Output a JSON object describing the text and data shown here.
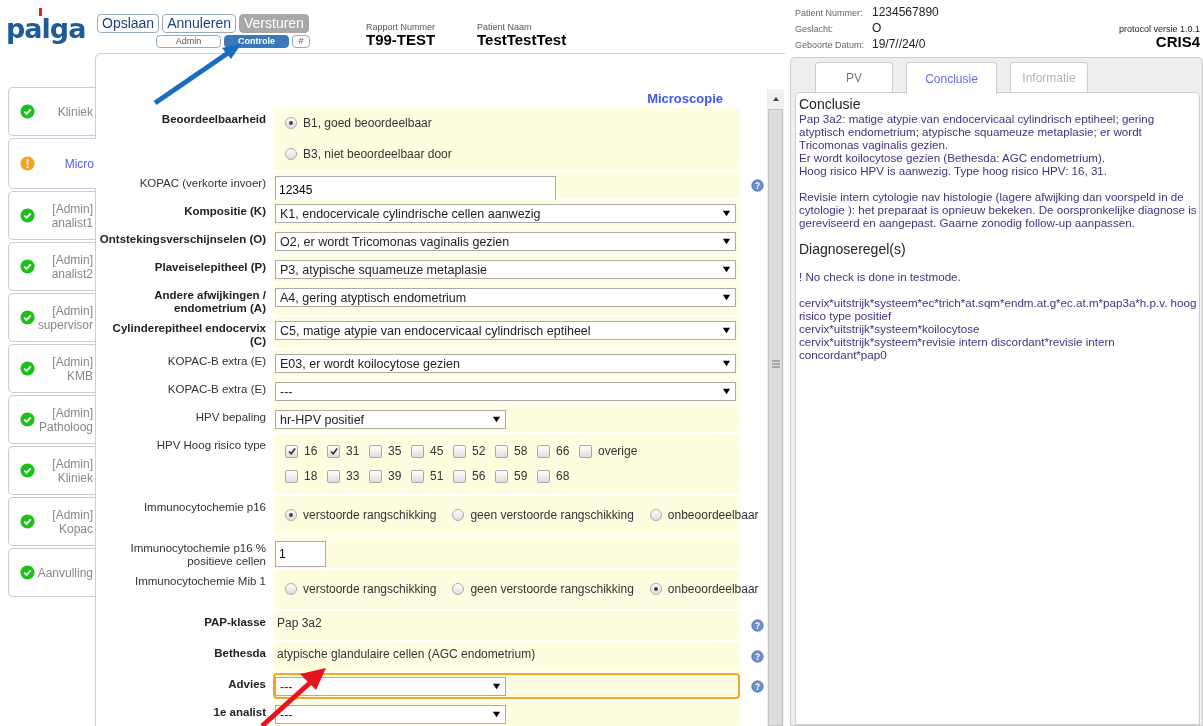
{
  "header": {
    "logo": "palga",
    "buttons": [
      {
        "label": "Opslaan",
        "disabled": false
      },
      {
        "label": "Annuleren",
        "disabled": false
      },
      {
        "label": "Versturen",
        "disabled": true
      }
    ],
    "mode_tabs": [
      {
        "label": "Admin",
        "selected": false
      },
      {
        "label": "Controle",
        "selected": true
      },
      {
        "label": "#",
        "selected": false
      }
    ],
    "report": [
      {
        "caption": "Rapport Nummer",
        "value": "T99-TEST"
      },
      {
        "caption": "Patient Naam",
        "value": "TestTestTest"
      }
    ]
  },
  "sidebar": {
    "items": [
      {
        "label": "Kliniek",
        "complete": true,
        "selected": false
      },
      {
        "label": "Micro",
        "complete": false,
        "selected": true
      },
      {
        "label": "[Admin] analist1",
        "complete": true,
        "selected": false
      },
      {
        "label": "[Admin] analist2",
        "complete": true,
        "selected": false
      },
      {
        "label": "[Admin] supervisor",
        "complete": true,
        "selected": false
      },
      {
        "label": "[Admin] KMB",
        "complete": true,
        "selected": false
      },
      {
        "label": "[Admin] Patholoog",
        "complete": true,
        "selected": false
      },
      {
        "label": "[Admin] Kliniek",
        "complete": true,
        "selected": false
      },
      {
        "label": "[Admin] Kopac",
        "complete": true,
        "selected": false
      },
      {
        "label": "Aanvulling",
        "complete": true,
        "selected": false
      }
    ]
  },
  "form": {
    "title": "Microscopie",
    "rows": [
      {
        "kind": "radio_list",
        "label": "Beoordeelbaarheid",
        "bold": true,
        "help": false,
        "options": [
          {
            "label": "B1, goed beoordeelbaar",
            "selected": true
          },
          {
            "label": "B3, niet beoordeelbaar door",
            "selected": false
          }
        ]
      },
      {
        "kind": "text_input",
        "label": "KOPAC (verkorte invoer)",
        "bold": false,
        "help": true,
        "value": "12345"
      },
      {
        "kind": "select",
        "label": "Kompositie (K)",
        "bold": true,
        "help": false,
        "focused": false,
        "value": "K1, endocervicale cylindrische cellen aanwezig"
      },
      {
        "kind": "select",
        "label": "Ontstekingsverschijnselen (O)",
        "bold": true,
        "help": false,
        "focused": false,
        "value": "O2, er wordt Tricomonas vaginalis gezien"
      },
      {
        "kind": "select",
        "label": "Plaveiselepitheel (P)",
        "bold": true,
        "help": false,
        "focused": false,
        "value": "P3, atypische squameuze metaplasie"
      },
      {
        "kind": "select",
        "label": "Andere afwijkingen / endometrium (A)",
        "bold": true,
        "help": false,
        "focused": false,
        "value": "A4, gering atyptisch endometrium"
      },
      {
        "kind": "select",
        "label": "Cylinderepitheel endocervix (C)",
        "bold": true,
        "help": false,
        "focused": false,
        "value": "C5, matige atypie van endocervicaal cylindrisch eptiheel"
      },
      {
        "kind": "select",
        "label": "KOPAC-B extra (E)",
        "bold": false,
        "help": false,
        "focused": false,
        "value": "E03, er wordt koilocytose gezien"
      },
      {
        "kind": "select",
        "label": "KOPAC-B extra (E)",
        "bold": false,
        "help": false,
        "focused": false,
        "value": "---"
      },
      {
        "kind": "short_select",
        "label": "HPV bepaling",
        "bold": false,
        "help": false,
        "focused": false,
        "value": "hr-HPV positief"
      },
      {
        "kind": "checkboxes",
        "label": "HPV Hoog risico type",
        "bold": false,
        "help": false,
        "option_rows": [
          {
            "options": [
              {
                "label": "16",
                "checked": true
              },
              {
                "label": "31",
                "checked": true
              },
              {
                "label": "35",
                "checked": false
              },
              {
                "label": "45",
                "checked": false
              },
              {
                "label": "52",
                "checked": false
              },
              {
                "label": "58",
                "checked": false
              },
              {
                "label": "66",
                "checked": false
              },
              {
                "label": "overige",
                "checked": false
              }
            ]
          },
          {
            "options": [
              {
                "label": "18",
                "checked": false
              },
              {
                "label": "33",
                "checked": false
              },
              {
                "label": "39",
                "checked": false
              },
              {
                "label": "51",
                "checked": false
              },
              {
                "label": "56",
                "checked": false
              },
              {
                "label": "59",
                "checked": false
              },
              {
                "label": "68",
                "checked": false
              }
            ]
          }
        ]
      },
      {
        "kind": "radio_row",
        "label": "Immunocytochemie p16",
        "bold": false,
        "help": false,
        "options": [
          {
            "label": "verstoorde rangschikking",
            "selected": true
          },
          {
            "label": "geen verstoorde rangschikking",
            "selected": false
          },
          {
            "label": "onbeoordeelbaar",
            "selected": false
          }
        ]
      },
      {
        "kind": "small_input",
        "label": "Immunocytochemie p16 % positieve cellen",
        "bold": false,
        "help": false,
        "value": "1"
      },
      {
        "kind": "radio_row",
        "label": "Immunocytochemie Mib 1",
        "bold": false,
        "help": false,
        "options": [
          {
            "label": "verstoorde rangschikking",
            "selected": false
          },
          {
            "label": "geen verstoorde rangschikking",
            "selected": false
          },
          {
            "label": "onbeoordeelbaar",
            "selected": true
          }
        ]
      },
      {
        "kind": "static",
        "label": "PAP-klasse",
        "bold": true,
        "help": true,
        "value": "Pap 3a2"
      },
      {
        "kind": "static",
        "label": "Bethesda",
        "bold": true,
        "help": true,
        "value": "atypische glandulaire cellen (AGC endometrium)"
      },
      {
        "kind": "short_select",
        "label": "Advies",
        "bold": true,
        "help": true,
        "focused": true,
        "value": "---"
      },
      {
        "kind": "short_select",
        "label": "1e analist",
        "bold": true,
        "help": false,
        "focused": false,
        "value": "---"
      }
    ]
  },
  "patient": {
    "fields": [
      {
        "label": "Patient Nummer:",
        "value": "1234567890"
      },
      {
        "label": "Geslacht:",
        "value": "O"
      },
      {
        "label": "Geboorte Datum:",
        "value": "19/7//24/0"
      }
    ],
    "protocol": "protocol versie 1.0.1",
    "code": "CRIS4"
  },
  "right_tabs": [
    {
      "label": "PV",
      "selected": false,
      "disabled": false
    },
    {
      "label": "Conclusie",
      "selected": true,
      "disabled": false
    },
    {
      "label": "Informatie",
      "selected": false,
      "disabled": true
    }
  ],
  "conclusion": {
    "blocks": [
      {
        "kind": "heading",
        "text": "Conclusie"
      },
      {
        "kind": "paragraph",
        "lines": [
          "Pap 3a2: matige atypie van endocervicaal cylindrisch eptiheel; gering atyptisch endometrium; atypische squameuze metaplasie; er wordt Tricomonas vaginalis gezien.",
          "Er wordt koilocytose gezien (Bethesda: AGC endometrium).",
          "Hoog risico HPV is aanwezig. Type hoog risico HPV: 16, 31."
        ]
      },
      {
        "kind": "paragraph",
        "lines": [
          "Revisie intern cytologie nav histologie (lagere afwijking dan voorspeld in de cytologie ): het preparaat is opnieuw bekeken. De oorspronkelijke diagnose is gereviseerd en aangepast. Gaarne zonodig follow-up aanpassen."
        ]
      },
      {
        "kind": "heading",
        "text": "Diagnoseregel(s)"
      },
      {
        "kind": "paragraph",
        "lines": [
          "! No check is done in testmode."
        ]
      },
      {
        "kind": "paragraph",
        "lines": [
          "cervix*uitstrijk*systeem*ec*trich*at.sqm*endm.at.g*ec.at.m*pap3a*h.p.v. hoog risico type positief",
          "cervix*uitstrijk*systeem*koilocytose",
          "cervix*uitstrijk*systeem*revisie intern discordant*revisie intern concordant*pap0"
        ]
      }
    ]
  },
  "annotation_arrows": [
    {
      "color": "#1a6cc0"
    },
    {
      "color": "#e8141b"
    }
  ]
}
